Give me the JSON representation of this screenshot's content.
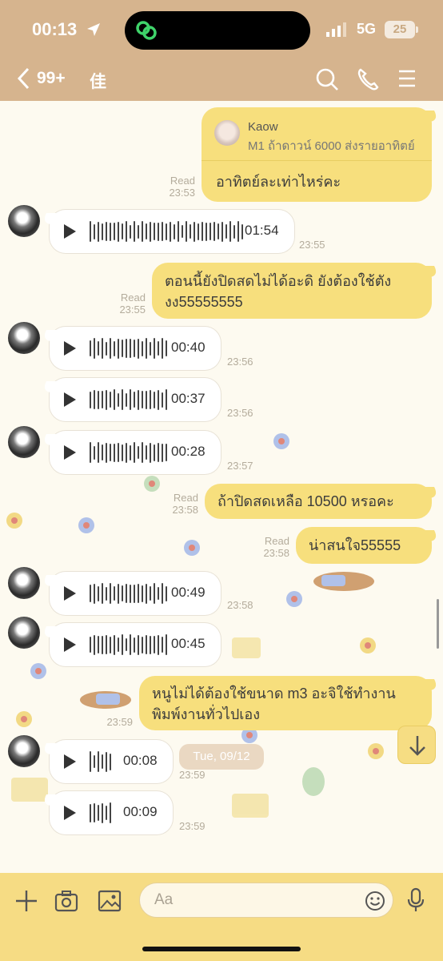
{
  "status_bar": {
    "time": "00:13",
    "network": "5G",
    "battery": "25"
  },
  "header": {
    "back_count": "99+",
    "title": "佳"
  },
  "reply_card": {
    "quoted_name": "Kaow",
    "quoted_text": "M1 ถ้าดาวน์ 6000 ส่งรายอาทิตย์",
    "text": "อาทิตย์ละเท่าไหร่คะ",
    "read": "Read",
    "time": "23:53"
  },
  "messages": [
    {
      "kind": "voice",
      "duration": "01:54",
      "time": "23:55"
    },
    {
      "kind": "text_out",
      "lines": [
        "ตอนนี้ยังปิดสดไม่ได้อะดิ ยังต้องใช้ตัง",
        "งง55555555"
      ],
      "read": "Read",
      "time": "23:55"
    },
    {
      "kind": "voice",
      "duration": "00:40",
      "time": "23:56"
    },
    {
      "kind": "voice",
      "duration": "00:37",
      "time": "23:56"
    },
    {
      "kind": "voice",
      "duration": "00:28",
      "time": "23:57"
    },
    {
      "kind": "text_out",
      "lines": [
        "ถ้าปิดสดเหลือ 10500 หรอคะ"
      ],
      "read": "Read",
      "time": "23:58"
    },
    {
      "kind": "text_out",
      "lines": [
        "น่าสนใจ55555"
      ],
      "read": "Read",
      "time": "23:58"
    },
    {
      "kind": "voice",
      "duration": "00:49",
      "time": "23:58"
    },
    {
      "kind": "voice",
      "duration": "00:45",
      "time": ""
    },
    {
      "kind": "text_out",
      "lines": [
        "หนูไม่ได้ต้องใช้ขนาด m3 อะจิใช้ทำงาน",
        "พิมพ์งานทั่วไปเอง"
      ],
      "read": "",
      "time": "23:59"
    },
    {
      "kind": "voice",
      "duration": "00:08",
      "time": "23:59"
    },
    {
      "kind": "voice",
      "duration": "00:09",
      "time": "23:59"
    }
  ],
  "date_divider": "Tue, 09/12",
  "composer": {
    "placeholder": "Aa"
  },
  "colors": {
    "header": "#d6b48e",
    "bubble_out": "#f7df7d",
    "chat_bg": "#fdfaf0"
  }
}
